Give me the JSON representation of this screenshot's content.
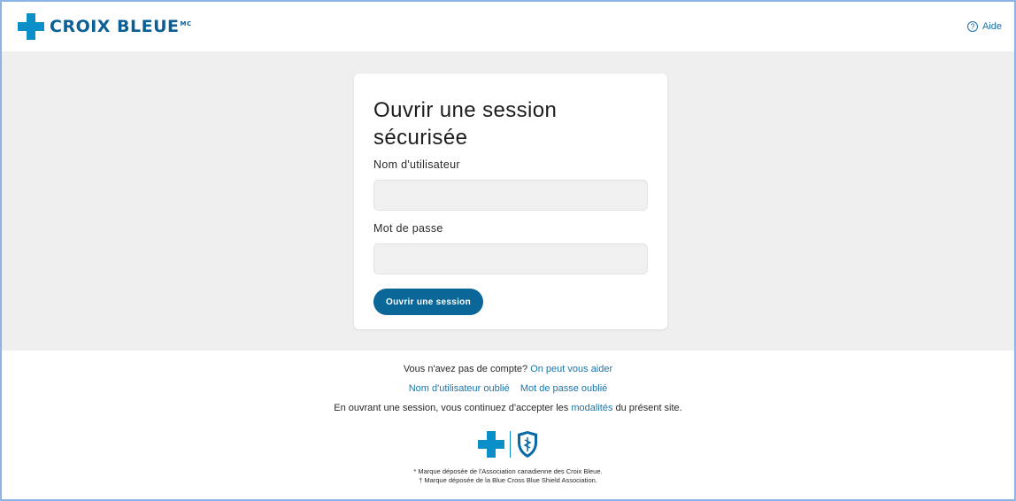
{
  "header": {
    "brand_name": "CROIX BLEUE",
    "brand_mark": "MC",
    "help_label": "Aide",
    "help_icon": "question-circle-icon"
  },
  "login": {
    "title": "Ouvrir une session sécurisée",
    "username_label": "Nom d'utilisateur",
    "username_value": "",
    "password_label": "Mot de passe",
    "password_value": "",
    "submit_label": "Ouvrir une session"
  },
  "footer": {
    "no_account_text": "Vous n'avez pas de compte?",
    "help_link": "On peut vous aider",
    "forgot_username": "Nom d'utilisateur oublié",
    "forgot_password": "Mot de passe oublié",
    "terms_prefix": "En ouvrant une session, vous continuez d'accepter les",
    "terms_link": "modalités",
    "terms_suffix": "du présent site.",
    "trademark_1": "* Marque déposée de l'Association canadienne des Croix Bleue.",
    "trademark_2": "† Marque déposée de la Blue Cross Blue Shield Association."
  },
  "colors": {
    "brand_blue": "#0a8fc8",
    "button_blue": "#0b6797",
    "link_blue": "#1a75aa",
    "band_grey": "#efefef"
  }
}
